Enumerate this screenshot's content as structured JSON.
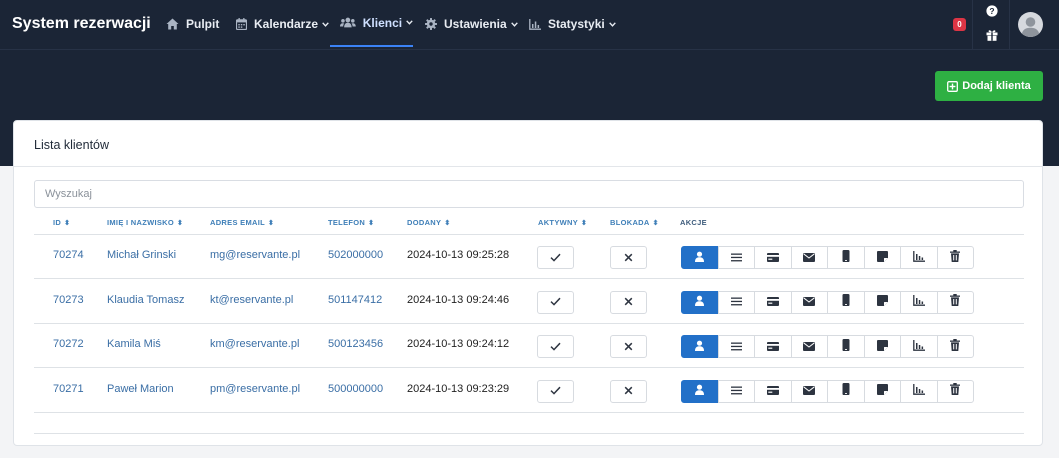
{
  "app": {
    "title": "System rezerwacji"
  },
  "nav": {
    "items": [
      {
        "label": "Pulpit",
        "icon": "home-icon"
      },
      {
        "label": "Kalendarze",
        "icon": "calendar-icon"
      },
      {
        "label": "Klienci",
        "icon": "users-icon"
      },
      {
        "label": "Ustawienia",
        "icon": "gear-icon"
      },
      {
        "label": "Statystyki",
        "icon": "chart-icon"
      }
    ],
    "active": "Klienci",
    "notification_count": "0",
    "help_label": "?"
  },
  "toolbar": {
    "add_label": "Dodaj klienta"
  },
  "card": {
    "title": "Lista klientów"
  },
  "search": {
    "placeholder": "Wyszukaj",
    "value": ""
  },
  "table": {
    "columns": [
      "ID",
      "IMIĘ I NAZWISKO",
      "ADRES EMAIL",
      "TELEFON",
      "DODANY",
      "AKTYWNY",
      "BLOKADA",
      "AKCJE"
    ],
    "rows": [
      {
        "id": "70274",
        "name": "Michał Grinski",
        "email": "mg@reservante.pl",
        "phone": "502000000",
        "added": "2024-10-13 09:25:28",
        "active": true,
        "blocked": false
      },
      {
        "id": "70273",
        "name": "Klaudia Tomasz",
        "email": "kt@reservante.pl",
        "phone": "501147412",
        "added": "2024-10-13 09:24:46",
        "active": true,
        "blocked": false
      },
      {
        "id": "70272",
        "name": "Kamila Miś",
        "email": "km@reservante.pl",
        "phone": "500123456",
        "added": "2024-10-13 09:24:12",
        "active": true,
        "blocked": false
      },
      {
        "id": "70271",
        "name": "Paweł Marion",
        "email": "pm@reservante.pl",
        "phone": "500000000",
        "added": "2024-10-13 09:23:29",
        "active": true,
        "blocked": false
      }
    ],
    "action_icons": [
      "user-icon",
      "list-icon",
      "credit-card-icon",
      "envelope-icon",
      "mobile-icon",
      "note-icon",
      "chart-icon",
      "trash-icon"
    ]
  },
  "colors": {
    "navbar": "#1b2536",
    "primary": "#2270c8",
    "success": "#2eb043",
    "danger": "#dc3545",
    "link": "#3a6ea5"
  }
}
